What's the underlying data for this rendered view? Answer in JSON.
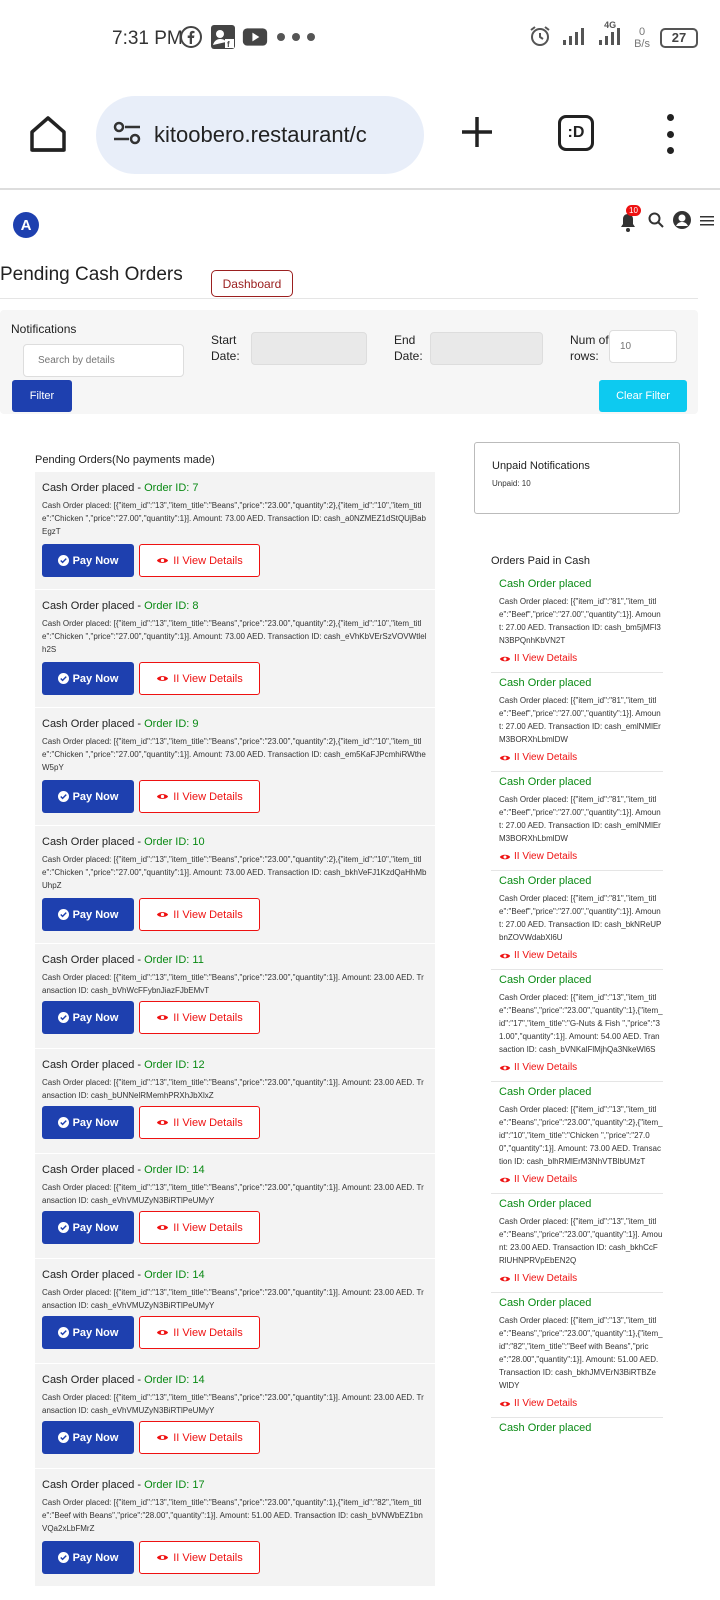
{
  "status_bar": {
    "time": "7:31 PM",
    "net_speed": "0",
    "net_unit": "B/s",
    "net_type": "4G",
    "battery": "27"
  },
  "browser": {
    "url": "kitoobero.restaurant/c",
    "tabs_label": ":D"
  },
  "header": {
    "avatar_letter": "A",
    "notif_count": "10"
  },
  "page": {
    "title": "Pending Cash Orders",
    "dashboard_label": "Dashboard"
  },
  "filters": {
    "notifications_label": "Notifications",
    "search_placeholder": "Search by details",
    "start_label": "Start Date:",
    "end_label": "End Date:",
    "rows_label": "Num of rows:",
    "rows_placeholder": "10",
    "filter_label": "Filter",
    "clear_label": "Clear Filter"
  },
  "pending": {
    "title": "Pending Orders(No payments made)",
    "pay_label": "Pay Now",
    "view_label": "II View Details",
    "head_prefix": "Cash Order placed - ",
    "orders": [
      {
        "oid": "Order ID: 7",
        "desc": "Cash Order placed: [{\"item_id\":\"13\",\"item_title\":\"Beans\",\"price\":\"23.00\",\"quantity\":2},{\"item_id\":\"10\",\"item_title\":\"Chicken \",\"price\":\"27.00\",\"quantity\":1}]. Amount: 73.00 AED. Transaction ID: cash_a0NZMEZ1dStQUjBabEgzT"
      },
      {
        "oid": "Order ID: 8",
        "desc": "Cash Order placed: [{\"item_id\":\"13\",\"item_title\":\"Beans\",\"price\":\"23.00\",\"quantity\":2},{\"item_id\":\"10\",\"item_title\":\"Chicken \",\"price\":\"27.00\",\"quantity\":1}]. Amount: 73.00 AED. Transaction ID: cash_eVhKbVErSzVOVWtlelh2S"
      },
      {
        "oid": "Order ID: 9",
        "desc": "Cash Order placed: [{\"item_id\":\"13\",\"item_title\":\"Beans\",\"price\":\"23.00\",\"quantity\":2},{\"item_id\":\"10\",\"item_title\":\"Chicken \",\"price\":\"27.00\",\"quantity\":1}]. Amount: 73.00 AED. Transaction ID: cash_em5KaFJPcmhiRWtheW5pY"
      },
      {
        "oid": "Order ID: 10",
        "desc": "Cash Order placed: [{\"item_id\":\"13\",\"item_title\":\"Beans\",\"price\":\"23.00\",\"quantity\":2},{\"item_id\":\"10\",\"item_title\":\"Chicken \",\"price\":\"27.00\",\"quantity\":1}]. Amount: 73.00 AED. Transaction ID: cash_bkhVeFJ1KzdQaHhMbUhpZ"
      },
      {
        "oid": "Order ID: 11",
        "desc": "Cash Order placed: [{\"item_id\":\"13\",\"item_title\":\"Beans\",\"price\":\"23.00\",\"quantity\":1}]. Amount: 23.00 AED. Transaction ID: cash_bVhWcFFybnJiazFJbEMvT"
      },
      {
        "oid": "Order ID: 12",
        "desc": "Cash Order placed: [{\"item_id\":\"13\",\"item_title\":\"Beans\",\"price\":\"23.00\",\"quantity\":1}]. Amount: 23.00 AED. Transaction ID: cash_bUNNelRMemhPRXhJbXlxZ"
      },
      {
        "oid": "Order ID: 14",
        "desc": "Cash Order placed: [{\"item_id\":\"13\",\"item_title\":\"Beans\",\"price\":\"23.00\",\"quantity\":1}]. Amount: 23.00 AED. Transaction ID: cash_eVhVMUZyN3BiRTlPeUMyY"
      },
      {
        "oid": "Order ID: 14",
        "desc": "Cash Order placed: [{\"item_id\":\"13\",\"item_title\":\"Beans\",\"price\":\"23.00\",\"quantity\":1}]. Amount: 23.00 AED. Transaction ID: cash_eVhVMUZyN3BiRTlPeUMyY"
      },
      {
        "oid": "Order ID: 14",
        "desc": "Cash Order placed: [{\"item_id\":\"13\",\"item_title\":\"Beans\",\"price\":\"23.00\",\"quantity\":1}]. Amount: 23.00 AED. Transaction ID: cash_eVhVMUZyN3BiRTlPeUMyY"
      },
      {
        "oid": "Order ID: 17",
        "desc": "Cash Order placed: [{\"item_id\":\"13\",\"item_title\":\"Beans\",\"price\":\"23.00\",\"quantity\":1},{\"item_id\":\"82\",\"item_title\":\"Beef with Beans\",\"price\":\"28.00\",\"quantity\":1}]. Amount: 51.00 AED. Transaction ID: cash_bVNWbEZ1bnVQa2xLbFMrZ"
      }
    ]
  },
  "unpaid": {
    "title": "Unpaid Notifications",
    "count": "Unpaid: 10"
  },
  "paid": {
    "title": "Orders Paid in Cash",
    "head": "Cash Order placed",
    "view_label": "II View Details",
    "items": [
      {
        "desc": "Cash Order placed: [{\"item_id\":\"81\",\"item_title\":\"Beef\",\"price\":\"27.00\",\"quantity\":1}]. Amount: 27.00 AED. Transaction ID: cash_bm5jMFl3N3BPQnhKbVN2T"
      },
      {
        "desc": "Cash Order placed: [{\"item_id\":\"81\",\"item_title\":\"Beef\",\"price\":\"27.00\",\"quantity\":1}]. Amount: 27.00 AED. Transaction ID: cash_emlNMlErM3BORXhLbmlDW"
      },
      {
        "desc": "Cash Order placed: [{\"item_id\":\"81\",\"item_title\":\"Beef\",\"price\":\"27.00\",\"quantity\":1}]. Amount: 27.00 AED. Transaction ID: cash_emlNMlErM3BORXhLbmlDW"
      },
      {
        "desc": "Cash Order placed: [{\"item_id\":\"81\",\"item_title\":\"Beef\",\"price\":\"27.00\",\"quantity\":1}]. Amount: 27.00 AED. Transaction ID: cash_bkNReUPbnZOVWdabXl6U"
      },
      {
        "desc": "Cash Order placed: [{\"item_id\":\"13\",\"item_title\":\"Beans\",\"price\":\"23.00\",\"quantity\":1},{\"item_id\":\"17\",\"item_title\":\"G-Nuts & Fish \",\"price\":\"31.00\",\"quantity\":1}]. Amount: 54.00 AED. Transaction ID: cash_bVNKalFlMjhQa3NkeWl6S"
      },
      {
        "desc": "Cash Order placed: [{\"item_id\":\"13\",\"item_title\":\"Beans\",\"price\":\"23.00\",\"quantity\":2},{\"item_id\":\"10\",\"item_title\":\"Chicken \",\"price\":\"27.00\",\"quantity\":1}]. Amount: 73.00 AED. Transaction ID: cash_blhRMlErM3NhVTBlbUMzT"
      },
      {
        "desc": "Cash Order placed: [{\"item_id\":\"13\",\"item_title\":\"Beans\",\"price\":\"23.00\",\"quantity\":1}]. Amount: 23.00 AED. Transaction ID: cash_bkhCcFRlUHNPRVpEbEN2Q"
      },
      {
        "desc": "Cash Order placed: [{\"item_id\":\"13\",\"item_title\":\"Beans\",\"price\":\"23.00\",\"quantity\":1},{\"item_id\":\"82\",\"item_title\":\"Beef with Beans\",\"price\":\"28.00\",\"quantity\":1}]. Amount: 51.00 AED. Transaction ID: cash_bkhJMVErN3BiRTBZeWlDY"
      }
    ],
    "more_label": "Cash Order placed"
  },
  "colors": {
    "primary": "#1e40af",
    "info": "#0dcaf0",
    "success": "#0a8a14",
    "danger": "#e11111"
  }
}
